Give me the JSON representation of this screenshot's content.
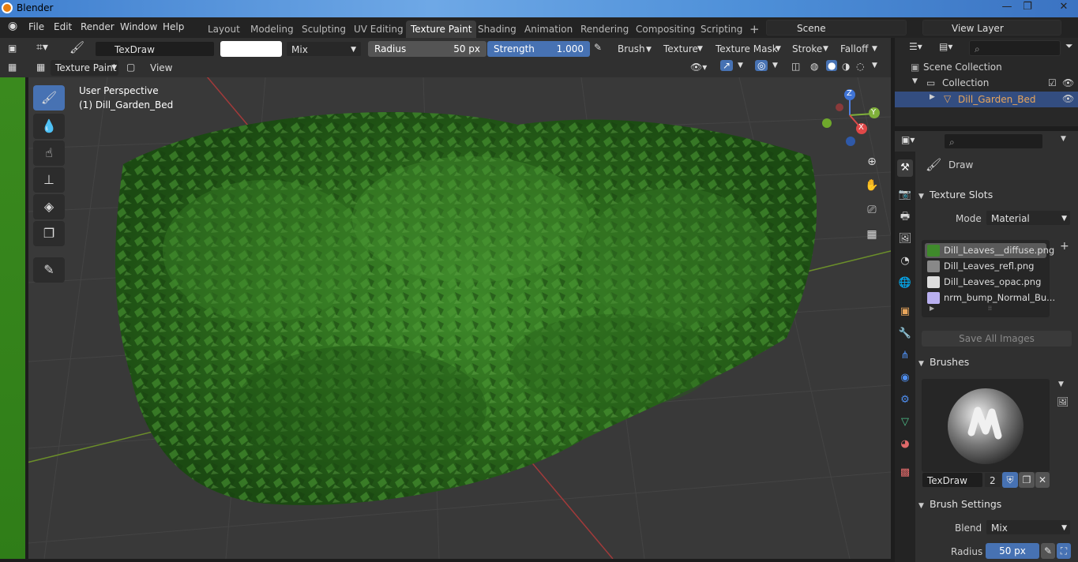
{
  "app": {
    "title": "Blender"
  },
  "menu": {
    "file": "File",
    "edit": "Edit",
    "render": "Render",
    "window": "Window",
    "help": "Help"
  },
  "workspaces": [
    "Layout",
    "Modeling",
    "Sculpting",
    "UV Editing",
    "Texture Paint",
    "Shading",
    "Animation",
    "Rendering",
    "Compositing",
    "Scripting"
  ],
  "active_workspace": "Texture Paint",
  "scene": {
    "name": "Scene",
    "view_layer": "View Layer"
  },
  "tool_header": {
    "brush_name": "TexDraw",
    "blend": "Mix",
    "radius_label": "Radius",
    "radius_value": "50 px",
    "strength_label": "Strength",
    "strength_value": "1.000",
    "menus": [
      "Brush",
      "Texture",
      "Texture Mask",
      "Stroke",
      "Falloff"
    ]
  },
  "viewport_header": {
    "mode": "Texture Paint",
    "view": "View"
  },
  "viewport": {
    "perspective": "User Perspective",
    "object": "(1) Dill_Garden_Bed"
  },
  "gizmo": {
    "x": "X",
    "y": "Y",
    "z": "Z"
  },
  "outliner": {
    "scene_collection": "Scene Collection",
    "collection": "Collection",
    "object": "Dill_Garden_Bed"
  },
  "properties": {
    "tool_name": "Draw",
    "texture_slots": {
      "title": "Texture Slots",
      "mode_label": "Mode",
      "mode_value": "Material",
      "slots": [
        "Dill_Leaves__diffuse.png",
        "Dill_Leaves_refl.png",
        "Dill_Leaves_opac.png",
        "nrm_bump_Normal_Bu..."
      ],
      "save_all": "Save All Images"
    },
    "brushes": {
      "title": "Brushes",
      "brush_name": "TexDraw",
      "users": "2"
    },
    "brush_settings": {
      "title": "Brush Settings",
      "blend_label": "Blend",
      "blend_value": "Mix",
      "radius_label": "Radius",
      "radius_value": "50 px"
    }
  },
  "colors": {
    "accent": "#4772b3",
    "active_object": "#e8a55b",
    "foliage": "#2f6d1e"
  }
}
